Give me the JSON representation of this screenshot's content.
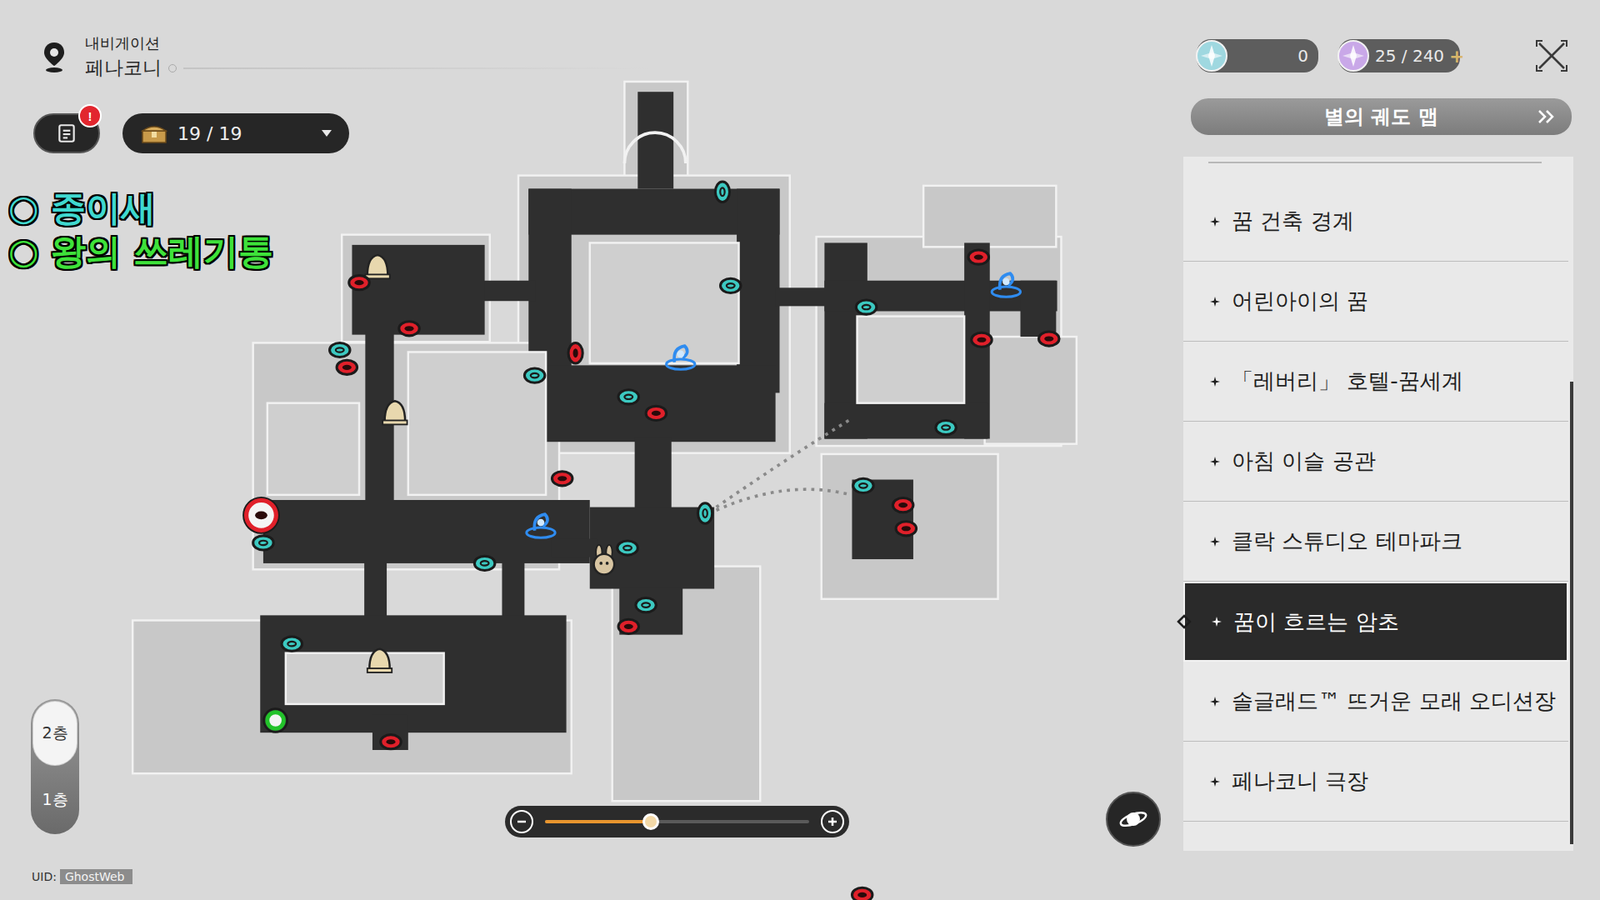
{
  "header": {
    "category": "내비게이션",
    "location": "페나코니"
  },
  "notice": {
    "badge": "!"
  },
  "chest_counter": {
    "value": "19 / 19"
  },
  "legend": [
    {
      "label": "○ 종이새",
      "color": "#3fd8cf"
    },
    {
      "label": "○ 왕의 쓰레기통",
      "color": "#3ee23a"
    }
  ],
  "currencies": [
    {
      "value": "0",
      "plus": ""
    },
    {
      "value": "25 / 240",
      "plus": "+"
    }
  ],
  "map_button": {
    "label": "별의 궤도 맵"
  },
  "areas": [
    {
      "label": "꿈 건축 경계",
      "selected": false
    },
    {
      "label": "어린아이의 꿈",
      "selected": false
    },
    {
      "label": "「레버리」 호텔-꿈세계",
      "selected": false
    },
    {
      "label": "아침 이슬 공관",
      "selected": false
    },
    {
      "label": "클락 스튜디오 테마파크",
      "selected": false
    },
    {
      "label": "꿈이 흐르는 암초",
      "selected": true
    },
    {
      "label": "솔글래드™ 뜨거운 모래 오디션장",
      "selected": false
    },
    {
      "label": "페나코니 극장",
      "selected": false
    }
  ],
  "floors": [
    {
      "label": "2층",
      "selected": true
    },
    {
      "label": "1층",
      "selected": false
    }
  ],
  "zoom": {
    "level": 0.4
  },
  "uid": {
    "label": "UID:",
    "value": "GhostWeb"
  },
  "map": {
    "markers": [
      {
        "kind": "paper-bird",
        "color": "#3cc9c1"
      },
      {
        "kind": "paper-bird",
        "color": "#3cc9c1"
      },
      {
        "kind": "paper-bird",
        "color": "#3cc9c1"
      },
      {
        "kind": "paper-bird",
        "color": "#3cc9c1"
      },
      {
        "kind": "paper-bird",
        "color": "#3cc9c1"
      },
      {
        "kind": "paper-bird",
        "color": "#3cc9c1"
      },
      {
        "kind": "paper-bird",
        "color": "#3cc9c1"
      },
      {
        "kind": "paper-bird",
        "color": "#3cc9c1"
      },
      {
        "kind": "paper-bird",
        "color": "#3cc9c1"
      },
      {
        "kind": "paper-bird",
        "color": "#3cc9c1"
      },
      {
        "kind": "paper-bird",
        "color": "#3cc9c1"
      },
      {
        "kind": "paper-bird",
        "color": "#3cc9c1"
      },
      {
        "kind": "paper-bird",
        "color": "#3cc9c1"
      },
      {
        "kind": "paper-bird",
        "color": "#3cc9c1"
      },
      {
        "kind": "trash-can",
        "color": "#e0202a"
      },
      {
        "kind": "trash-can",
        "color": "#e0202a"
      },
      {
        "kind": "trash-can",
        "color": "#e0202a"
      },
      {
        "kind": "trash-can",
        "color": "#e0202a"
      },
      {
        "kind": "trash-can",
        "color": "#e0202a"
      },
      {
        "kind": "trash-can",
        "color": "#e0202a"
      },
      {
        "kind": "trash-can",
        "color": "#e0202a"
      },
      {
        "kind": "trash-can",
        "color": "#e0202a"
      },
      {
        "kind": "trash-can",
        "color": "#e0202a"
      },
      {
        "kind": "trash-can",
        "color": "#e0202a"
      },
      {
        "kind": "trash-can",
        "color": "#e0202a"
      },
      {
        "kind": "trash-can",
        "color": "#e0202a"
      },
      {
        "kind": "trash-can",
        "color": "#e0202a"
      },
      {
        "kind": "trash-can",
        "color": "#e0202a"
      },
      {
        "kind": "trash-can-large",
        "color": "#e0202a"
      },
      {
        "kind": "green-marker",
        "color": "#22c22a"
      }
    ]
  }
}
